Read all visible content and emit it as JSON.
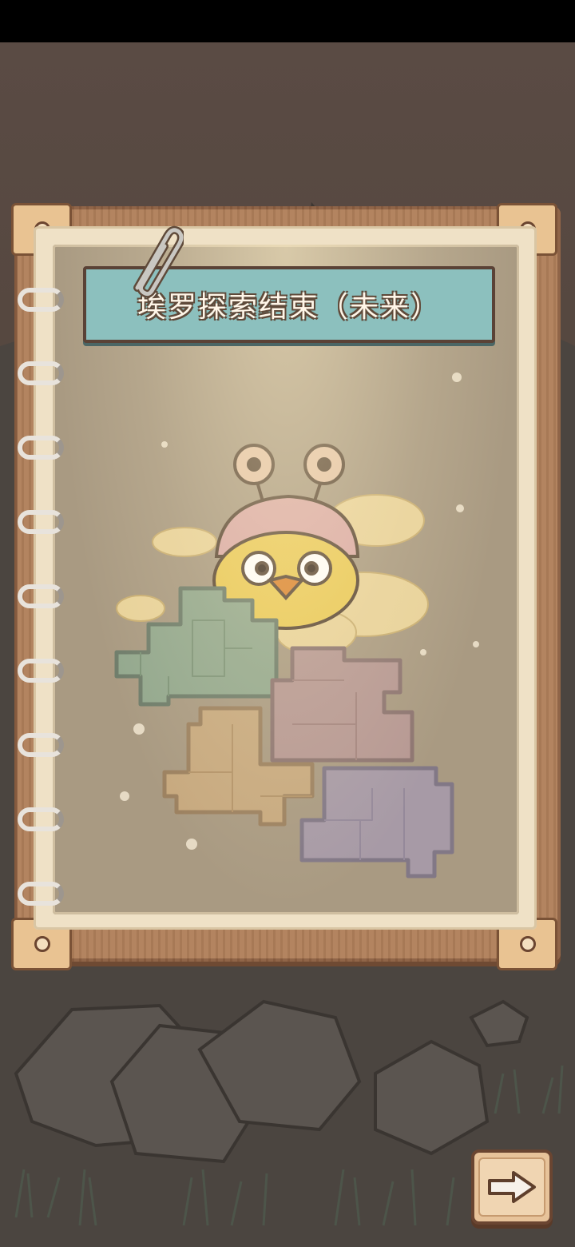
{
  "title": "埃罗探索结束（未来）",
  "colors": {
    "banner": "#8cc0be",
    "piece_green": "#93a88e",
    "piece_pink": "#b69893",
    "piece_tan": "#c7a97f",
    "piece_purple": "#a79aa6"
  },
  "icons": {
    "next": "arrow-right-icon",
    "clip": "paperclip-icon"
  }
}
